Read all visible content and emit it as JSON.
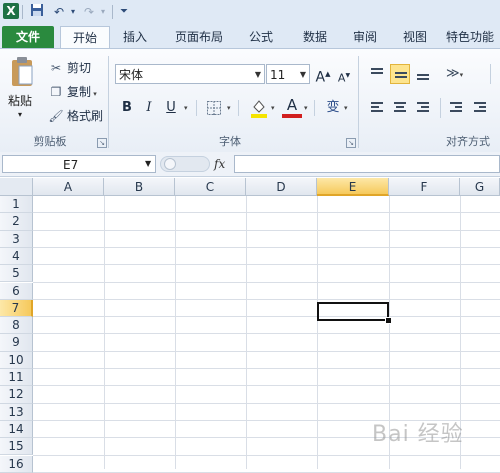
{
  "titlebar": {
    "app_icon_letter": "X",
    "qat": [
      "save",
      "undo",
      "redo",
      "customize"
    ]
  },
  "tabs": [
    {
      "label": "文件",
      "file": true
    },
    {
      "label": "开始",
      "active": true
    },
    {
      "label": "插入"
    },
    {
      "label": "页面布局"
    },
    {
      "label": "公式"
    },
    {
      "label": "数据"
    },
    {
      "label": "审阅"
    },
    {
      "label": "视图"
    },
    {
      "label": "特色功能"
    }
  ],
  "clipboard": {
    "paste": "粘贴",
    "cut": "剪切",
    "copy": "复制",
    "format_painter": "格式刷",
    "group_label": "剪贴板"
  },
  "font": {
    "name": "宋体",
    "size": "11",
    "bold": "B",
    "italic": "I",
    "underline": "U",
    "grow": "A",
    "shrink": "A",
    "font_color_letter": "A",
    "phonetic": "变",
    "group_label": "字体",
    "font_color": "#d11f1f",
    "fill_color": "#f5e400"
  },
  "alignment": {
    "group_label": "对齐方式"
  },
  "formula_bar": {
    "name_box": "E7",
    "fx": "fx",
    "value": ""
  },
  "sheet": {
    "columns": [
      "A",
      "B",
      "C",
      "D",
      "E",
      "F",
      "G"
    ],
    "rows": [
      "1",
      "2",
      "3",
      "4",
      "5",
      "6",
      "7",
      "8",
      "9",
      "10",
      "11",
      "12",
      "13",
      "14",
      "15",
      "16"
    ],
    "selected_column": "E",
    "selected_row": "7",
    "active_cell": "E7"
  },
  "watermark": "Bai 经验"
}
